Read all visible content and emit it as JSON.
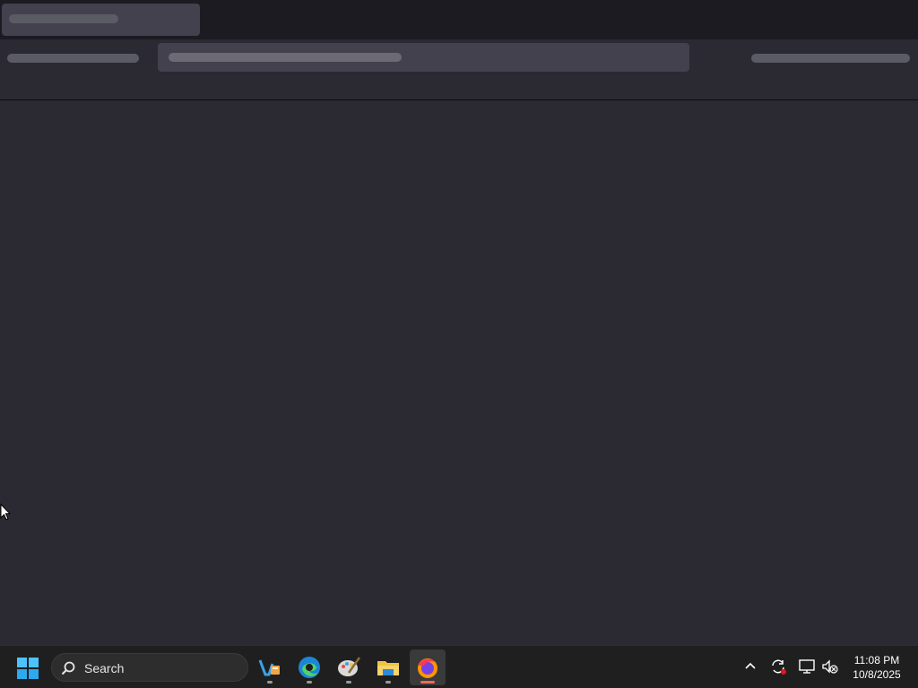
{
  "taskbar": {
    "search_placeholder": "Search",
    "apps": [
      {
        "name": "vscode-app"
      },
      {
        "name": "edge-browser-app"
      },
      {
        "name": "paint-app"
      },
      {
        "name": "file-explorer-app"
      },
      {
        "name": "firefox-app",
        "active": true
      }
    ],
    "clock": {
      "time": "11:08 PM",
      "date": "10/8/2025"
    }
  },
  "colors": {
    "background": "#2b2a33",
    "tabstrip": "#1c1b22",
    "skeleton": "#5b5b66",
    "taskbar": "#1f1f1f",
    "active_indicator": "#f06a5b"
  }
}
